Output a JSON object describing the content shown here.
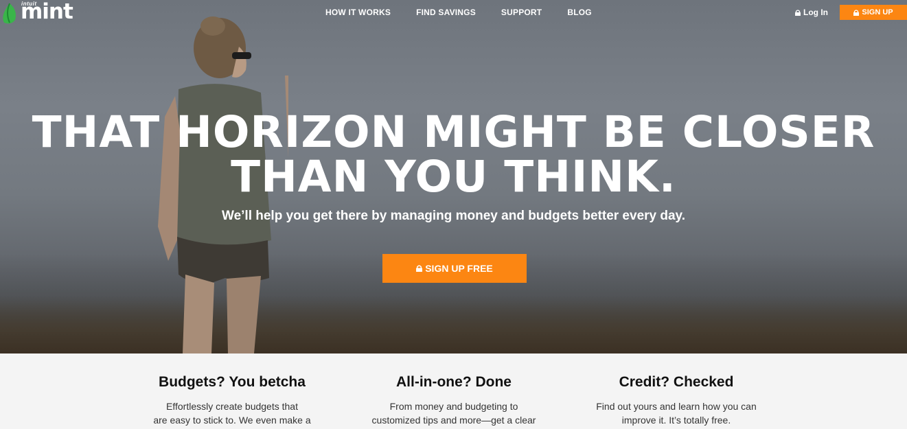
{
  "brand": {
    "name": "mint",
    "parent": "intuit"
  },
  "nav": {
    "items": [
      {
        "label": "HOW IT WORKS"
      },
      {
        "label": "FIND SAVINGS"
      },
      {
        "label": "SUPPORT"
      },
      {
        "label": "BLOG"
      }
    ],
    "login_label": "Log In",
    "signup_label": "SIGN UP"
  },
  "hero": {
    "headline_line1": "THAT HORIZON MIGHT BE CLOSER",
    "headline_line2": "THAN YOU THINK.",
    "subhead": "We’ll help you get there by managing money and budgets better every day.",
    "cta_label": "SIGN UP FREE"
  },
  "features": [
    {
      "title": "Budgets? You betcha",
      "line1": "Effortlessly create budgets that",
      "line2": "are easy to stick to. We even make a"
    },
    {
      "title": "All-in-one? Done",
      "line1": "From money and budgeting to",
      "line2": "customized tips and more—get a clear"
    },
    {
      "title": "Credit? Checked",
      "line1": "Find out yours and learn how you can",
      "line2": "improve it. It’s totally free."
    }
  ],
  "colors": {
    "accent": "#fc8612",
    "brand_green": "#3ab54a",
    "hero_bg": "#737980"
  },
  "icons": {
    "lock": "lock-icon",
    "leaf": "mint-leaf-icon"
  }
}
